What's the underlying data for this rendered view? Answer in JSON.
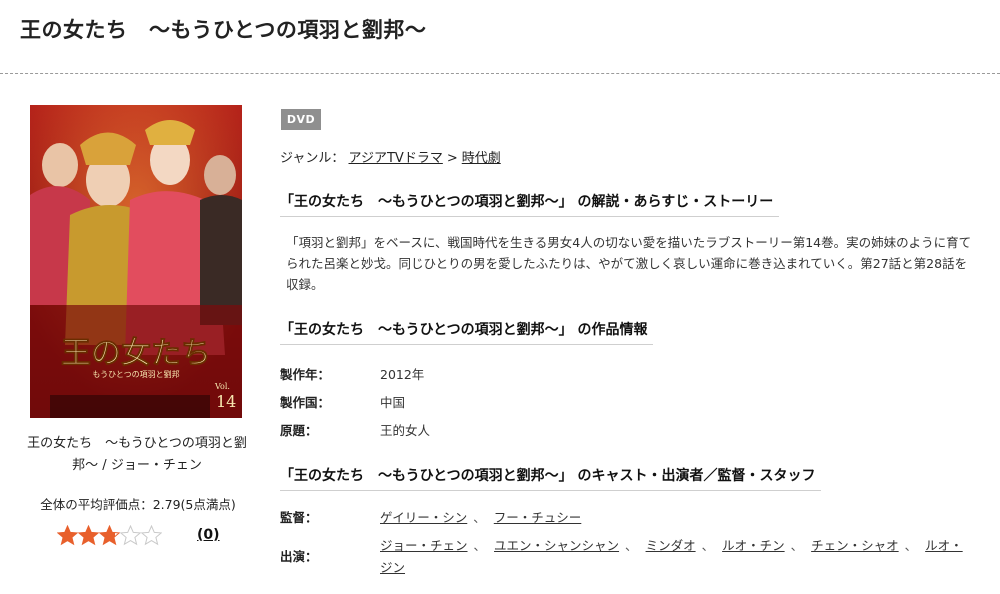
{
  "page": {
    "title": "王の女たち　〜もうひとつの項羽と劉邦〜"
  },
  "item": {
    "cover_title": "王の女たち",
    "cover_subtitle": "もうひとつの項羽と劉邦",
    "cover_volume_prefix": "Vol.",
    "cover_volume": "14",
    "caption": "王の女たち　〜もうひとつの項羽と劉邦〜 / ジョー・チェン",
    "rating_text": "全体の平均評価点：2.79(5点満点)",
    "rating_value": 2.79,
    "rating_max": 5,
    "rating_count": "(0)"
  },
  "badge": {
    "label": "DVD"
  },
  "genre": {
    "label": "ジャンル：",
    "links": [
      "アジアTVドラマ",
      "時代劇"
    ],
    "separator": ">"
  },
  "sections": {
    "synopsis_heading": "「王の女たち　〜もうひとつの項羽と劉邦〜」 の解説・あらすじ・ストーリー",
    "synopsis_text": "「項羽と劉邦」をベースに、戦国時代を生きる男女4人の切ない愛を描いたラブストーリー第14巻。実の姉妹のように育てられた呂楽と妙戈。同じひとりの男を愛したふたりは、やがて激しく哀しい運命に巻き込まれていく。第27話と第28話を収録。",
    "info_heading": "「王の女たち　〜もうひとつの項羽と劉邦〜」 の作品情報",
    "cast_heading": "「王の女たち　〜もうひとつの項羽と劉邦〜」 のキャスト・出演者／監督・スタッフ"
  },
  "info": [
    {
      "label": "製作年：",
      "value": "2012年"
    },
    {
      "label": "製作国：",
      "value": "中国"
    },
    {
      "label": "原題：",
      "value": "王的女人"
    }
  ],
  "staff": {
    "director_label": "監督：",
    "directors": [
      "ゲイリー・シン",
      "フー・チュシー"
    ],
    "cast_label": "出演：",
    "cast": [
      "ジョー・チェン",
      "ユエン・シャンシャン",
      "ミンダオ",
      "ルオ・チン",
      "チェン・シャオ",
      "ルオ・ジン"
    ],
    "separator": "、"
  },
  "colors": {
    "star_filled": "#e8602c",
    "star_empty": "#c9c9c9",
    "badge_bg": "#8f8f8f"
  }
}
